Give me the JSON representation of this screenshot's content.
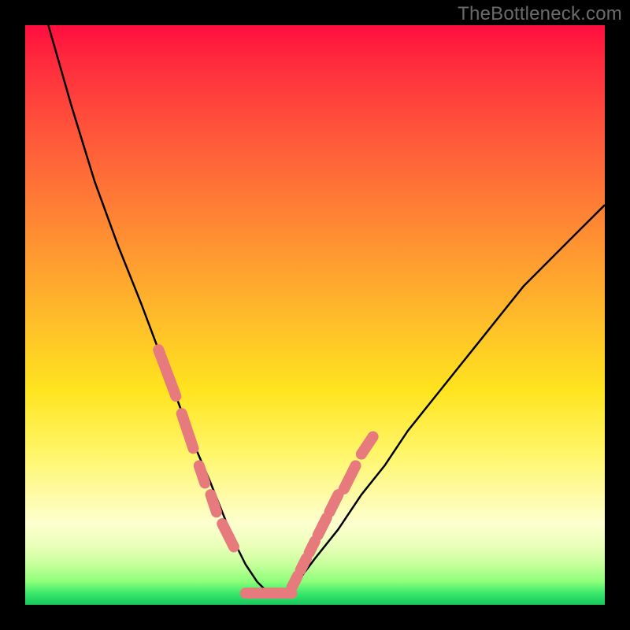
{
  "watermark": "TheBottleneck.com",
  "colors": {
    "frame": "#000000",
    "curve": "#000000",
    "highlight": "#e77a7c"
  },
  "chart_data": {
    "type": "line",
    "title": "",
    "xlabel": "",
    "ylabel": "",
    "xlim": [
      0,
      100
    ],
    "ylim": [
      0,
      100
    ],
    "grid": false,
    "legend": false,
    "series": [
      {
        "name": "bottleneck-curve",
        "x": [
          4,
          8,
          12,
          16,
          20,
          23,
          26,
          29,
          32,
          34,
          36,
          38,
          40,
          42,
          44,
          47,
          50,
          54,
          58,
          62,
          66,
          70,
          74,
          78,
          82,
          86,
          90,
          94,
          98,
          100
        ],
        "y": [
          100,
          86,
          73,
          62,
          52,
          44,
          36,
          28,
          21,
          16,
          11,
          7,
          4,
          2,
          2,
          4,
          8,
          13,
          19,
          24,
          30,
          35,
          40,
          45,
          50,
          55,
          59,
          63,
          67,
          69
        ]
      }
    ],
    "annotations": {
      "highlight_segments_left": [
        {
          "x0": 23,
          "y0": 44,
          "x1": 26,
          "y1": 36
        },
        {
          "x0": 27,
          "y0": 33,
          "x1": 29,
          "y1": 27
        },
        {
          "x0": 30,
          "y0": 24,
          "x1": 31,
          "y1": 21
        },
        {
          "x0": 32,
          "y0": 19,
          "x1": 33,
          "y1": 16
        },
        {
          "x0": 34,
          "y0": 14,
          "x1": 36,
          "y1": 10
        }
      ],
      "highlight_bottom": {
        "x0": 38,
        "x1": 46,
        "y": 2
      },
      "highlight_segments_right": [
        {
          "x0": 46,
          "y0": 3,
          "x1": 47,
          "y1": 5
        },
        {
          "x0": 47.5,
          "y0": 6,
          "x1": 48.5,
          "y1": 8
        },
        {
          "x0": 49,
          "y0": 9,
          "x1": 50,
          "y1": 11
        },
        {
          "x0": 50.5,
          "y0": 12,
          "x1": 52,
          "y1": 15
        },
        {
          "x0": 52.5,
          "y0": 16,
          "x1": 54,
          "y1": 19
        },
        {
          "x0": 55,
          "y0": 20,
          "x1": 57,
          "y1": 24
        },
        {
          "x0": 58,
          "y0": 26,
          "x1": 60,
          "y1": 29
        }
      ]
    }
  }
}
